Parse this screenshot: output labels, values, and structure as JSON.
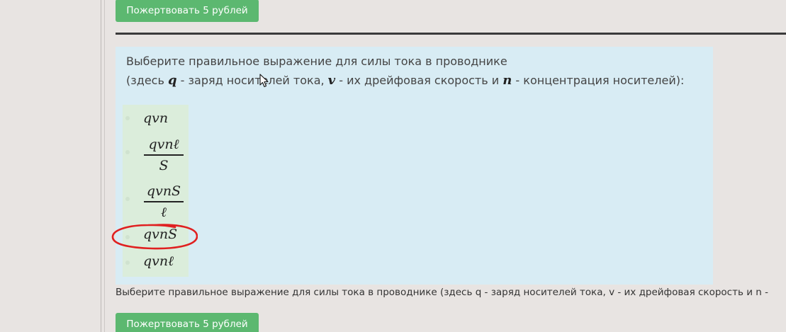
{
  "donate_top": {
    "label": "Пожертвовать 5 рублей"
  },
  "donate_bottom": {
    "label": "Пожертвовать 5 рублей"
  },
  "question": {
    "line1": "Выберите правильное выражение для силы тока в проводнике",
    "line2_parts": {
      "p1": "(здесь ",
      "var_q": "q",
      "p2": " - заряд носителей тока, ",
      "var_v": "v",
      "p3": " - их дрейфовая скорость и ",
      "var_n": "n",
      "p4": " - концентрация носителей):"
    }
  },
  "options": [
    {
      "text": "qvn"
    },
    {
      "numerator": "qvnℓ",
      "denominator": "S"
    },
    {
      "numerator": "qvnS",
      "denominator": "ℓ"
    },
    {
      "text": "qvnS",
      "circled": true
    },
    {
      "text": "qvnℓ"
    }
  ],
  "footer_text": "Выберите правильное выражение для силы тока в проводнике (здесь q - заряд носителей тока, v - их дрейфовая скорость и n -",
  "colors": {
    "button_green": "#5cb870",
    "question_bg": "#d8ecf4",
    "options_bg": "#dbeddb",
    "annotation_red": "#e02020"
  },
  "icons": {
    "cursor": "mouse-pointer-icon"
  }
}
